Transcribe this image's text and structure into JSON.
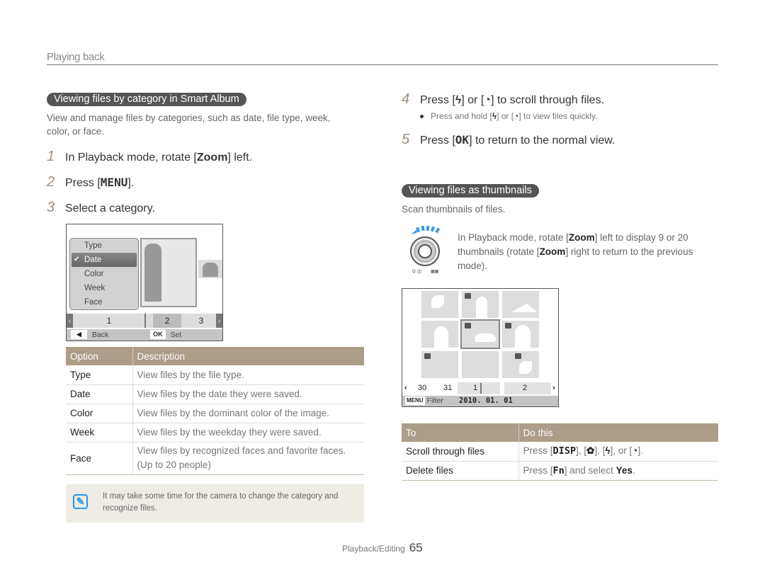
{
  "header": {
    "section": "Playing back"
  },
  "left": {
    "heading": "Viewing files by category in Smart Album",
    "intro": "View and manage files by categories, such as date, file type, week, color, or face.",
    "steps": [
      {
        "num": "1",
        "pre": "In Playback mode, rotate [",
        "key": "Zoom",
        "post": "] left."
      },
      {
        "num": "2",
        "pre": "Press [",
        "key": "MENU",
        "post": "]."
      },
      {
        "num": "3",
        "pre": "Select a category.",
        "key": "",
        "post": ""
      }
    ],
    "camera_screen": {
      "menu_items": [
        "Type",
        "Date",
        "Color",
        "Week",
        "Face"
      ],
      "selected_item": "Date",
      "pages": [
        "1",
        "2",
        "3"
      ],
      "back_label": "Back",
      "ok_key": "OK",
      "set_label": "Set"
    },
    "table": {
      "headers": [
        "Option",
        "Description"
      ],
      "rows": [
        {
          "option": "Type",
          "description": "View files by the file type."
        },
        {
          "option": "Date",
          "description": "View files by the date they were saved."
        },
        {
          "option": "Color",
          "description": "View files by the dominant color of the image."
        },
        {
          "option": "Week",
          "description": "View files by the weekday they were saved."
        },
        {
          "option": "Face",
          "description": "View files by recognized faces and favorite faces.",
          "description2": "(Up to 20 people)"
        }
      ]
    },
    "note": "It may take some time for the camera to change the category and recognize files."
  },
  "right": {
    "steps": [
      {
        "num": "4",
        "text1": "Press [",
        "icon1": "flash",
        "text2": "] or [",
        "icon2": "timer",
        "text3": "] to scroll through files."
      },
      {
        "num": "5",
        "text1": "Press [",
        "key": "OK",
        "text2": "] to return to the normal view."
      }
    ],
    "bullet": {
      "text1": "Press and hold [",
      "text2": "] or [",
      "text3": "] to view files quickly."
    },
    "heading": "Viewing files as thumbnails",
    "intro": "Scan thumbnails of files.",
    "thumb_desc": {
      "pre": "In Playback mode, rotate [",
      "key1": "Zoom",
      "mid": "] left to display 9 or 20 thumbnails (rotate [",
      "key2": "Zoom",
      "post": "] right to return to the previous mode)."
    },
    "camera_screen": {
      "nav_labels": [
        "30",
        "31",
        "1",
        "2"
      ],
      "menu_key": "MENU",
      "filter_label": "Filter",
      "date": "2010. 01. 01"
    },
    "table": {
      "headers": [
        "To",
        "Do this"
      ],
      "rows": [
        {
          "to": "Scroll through files",
          "pre": "Press [",
          "key": "DISP",
          "post": "], [",
          "post2": "], [",
          "post3": "], or [",
          "post4": "]."
        },
        {
          "to": "Delete files",
          "pre": "Press [",
          "key": "Fn",
          "post": "] and select ",
          "bold": "Yes",
          "end": "."
        }
      ]
    }
  },
  "footer": {
    "label": "Playback/Editing",
    "page": "65"
  }
}
